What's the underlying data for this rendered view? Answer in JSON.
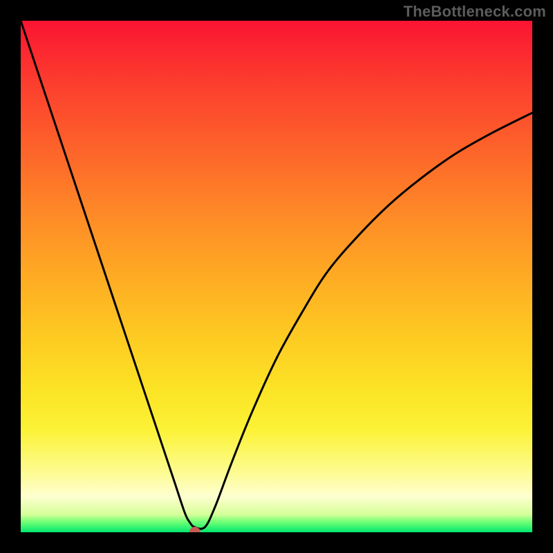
{
  "watermark": "TheBottleneck.com",
  "chart_data": {
    "type": "line",
    "title": "",
    "xlabel": "",
    "ylabel": "",
    "xlim": [
      0,
      100
    ],
    "ylim": [
      0,
      100
    ],
    "grid": false,
    "legend": "none",
    "background_gradient": {
      "direction": "vertical",
      "stops": [
        {
          "pos": 0.0,
          "color": "#fb1432"
        },
        {
          "pos": 0.12,
          "color": "#fc3d2e"
        },
        {
          "pos": 0.25,
          "color": "#fd632a"
        },
        {
          "pos": 0.38,
          "color": "#fe8a27"
        },
        {
          "pos": 0.5,
          "color": "#feab23"
        },
        {
          "pos": 0.62,
          "color": "#fdcb22"
        },
        {
          "pos": 0.72,
          "color": "#fce325"
        },
        {
          "pos": 0.8,
          "color": "#fcf236"
        },
        {
          "pos": 0.88,
          "color": "#fdfb8e"
        },
        {
          "pos": 0.93,
          "color": "#feffd0"
        },
        {
          "pos": 0.965,
          "color": "#d7ff9a"
        },
        {
          "pos": 0.98,
          "color": "#6eff75"
        },
        {
          "pos": 1.0,
          "color": "#00e86f"
        }
      ]
    },
    "series": [
      {
        "name": "curve",
        "x": [
          0,
          3,
          6,
          9,
          12,
          15,
          18,
          21,
          24,
          27,
          30,
          32,
          33,
          34,
          36,
          38,
          41,
          45,
          50,
          55,
          60,
          66,
          72,
          78,
          85,
          92,
          100
        ],
        "y": [
          100,
          91,
          82,
          73,
          64,
          55,
          46,
          37,
          28,
          19,
          10,
          4,
          2,
          1,
          1,
          5,
          13,
          23,
          34,
          43,
          51,
          58,
          64,
          69,
          74,
          78,
          82
        ]
      }
    ],
    "marker": {
      "x": 34,
      "y": 0,
      "color": "#c75a55"
    },
    "curve_min": {
      "x": 34,
      "y": 1
    },
    "right_endpoint": {
      "x": 100,
      "y": 82
    }
  }
}
